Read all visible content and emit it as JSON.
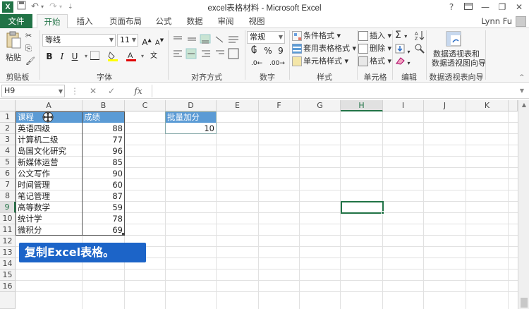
{
  "window": {
    "title": "excel表格材料 - Microsoft Excel",
    "help": "?",
    "minimize": "—",
    "restore": "❐",
    "close": "✕"
  },
  "tabs": {
    "file": "文件",
    "items": [
      "开始",
      "插入",
      "页面布局",
      "公式",
      "数据",
      "审阅",
      "视图"
    ],
    "active": "开始",
    "user": "Lynn Fu"
  },
  "ribbon": {
    "clipboard": {
      "paste": "粘贴",
      "group": "剪贴板"
    },
    "font": {
      "name": "等线",
      "size": "11",
      "bold": "B",
      "italic": "I",
      "underline": "U",
      "grow": "A",
      "shrink": "A",
      "group": "字体"
    },
    "alignment": {
      "group": "对齐方式"
    },
    "number": {
      "format": "常规",
      "percent": "%",
      "comma": "9",
      "group": "数字"
    },
    "styles": {
      "conditional": "条件格式",
      "table": "套用表格格式",
      "cell": "单元格样式",
      "group": "样式"
    },
    "cells": {
      "insert": "插入",
      "delete": "删除",
      "format": "格式",
      "group": "单元格"
    },
    "editing": {
      "group": "编辑"
    },
    "pivot": {
      "line1": "数据透视表和",
      "line2": "数据透视图向导",
      "group": "数据透视表向导"
    }
  },
  "formula_bar": {
    "name_box": "H9",
    "cancel": "✕",
    "enter": "✓",
    "fx": "fx",
    "value": ""
  },
  "sheet": {
    "columns": [
      "A",
      "B",
      "C",
      "D",
      "E",
      "F",
      "G",
      "H",
      "I",
      "J",
      "K"
    ],
    "rows": [
      "1",
      "2",
      "3",
      "4",
      "5",
      "6",
      "7",
      "8",
      "9",
      "10",
      "11",
      "12",
      "13",
      "14",
      "15",
      "16"
    ],
    "selected_column": "H",
    "selected_row": "9",
    "table": {
      "headers": [
        "课程",
        "成绩"
      ],
      "rows": [
        [
          "英语四级",
          "88"
        ],
        [
          "计算机二级",
          "77"
        ],
        [
          "岛国文化研究",
          "96"
        ],
        [
          "新媒体运营",
          "85"
        ],
        [
          "公文写作",
          "90"
        ],
        [
          "时间管理",
          "60"
        ],
        [
          "笔记管理",
          "87"
        ],
        [
          "高等数学",
          "59"
        ],
        [
          "统计学",
          "78"
        ],
        [
          "微积分",
          "69"
        ]
      ]
    },
    "batch": {
      "header": "批量加分",
      "value": "10"
    },
    "caption": "复制Excel表格。"
  },
  "colors": {
    "excel_green": "#217346",
    "header_blue": "#5b9bd5",
    "caption_blue": "#1c64c8"
  }
}
